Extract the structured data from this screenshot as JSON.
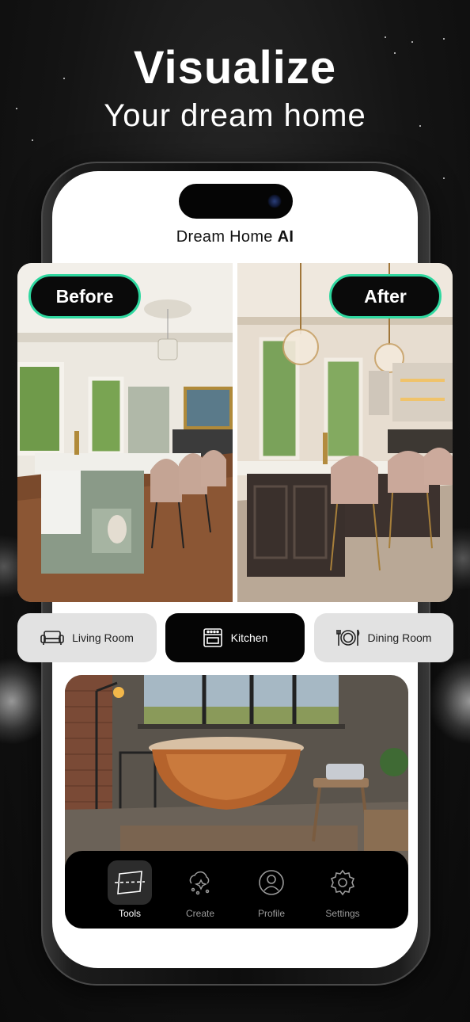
{
  "headline": {
    "title": "Visualize",
    "subtitle": "Your dream home"
  },
  "app": {
    "title_main": "Dream Home",
    "title_bold": "AI"
  },
  "comparison": {
    "before_label": "Before",
    "after_label": "After",
    "accent_color": "#2fd8a0"
  },
  "room_tabs": [
    {
      "label": "Living Room",
      "icon": "sofa-icon",
      "selected": false
    },
    {
      "label": "Kitchen",
      "icon": "stove-icon",
      "selected": true
    },
    {
      "label": "Dining Room",
      "icon": "plate-cutlery-icon",
      "selected": false
    }
  ],
  "bottom_nav": [
    {
      "label": "Tools",
      "icon": "scan-frame-icon",
      "active": true
    },
    {
      "label": "Create",
      "icon": "magic-cloud-icon",
      "active": false
    },
    {
      "label": "Profile",
      "icon": "user-circle-icon",
      "active": false
    },
    {
      "label": "Settings",
      "icon": "gear-icon",
      "active": false
    }
  ]
}
